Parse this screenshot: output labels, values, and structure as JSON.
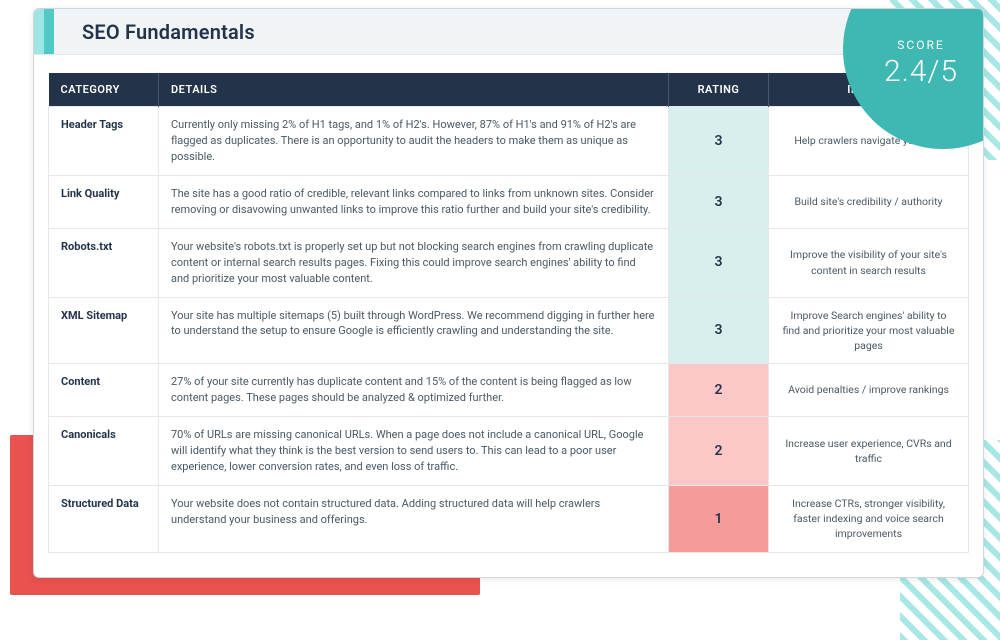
{
  "header": {
    "title": "SEO Fundamentals"
  },
  "score": {
    "label": "SCORE",
    "value": "2.4/5"
  },
  "table": {
    "headers": {
      "category": "CATEGORY",
      "details": "DETAILS",
      "rating": "RATING",
      "impact": "IMPACT"
    },
    "rows": [
      {
        "category": "Header Tags",
        "details": "Currently only missing 2% of H1 tags, and 1% of H2's. However, 87% of H1's and 91% of H2's are flagged as duplicates. There is an opportunity to audit the headers to make them as unique as possible.",
        "rating": "3",
        "rating_level": "good",
        "impact": "Help crawlers navigate your site"
      },
      {
        "category": "Link Quality",
        "details": "The site has a good ratio of credible, relevant links compared to links from unknown sites. Consider removing or disavowing unwanted links to improve this ratio further and build your site's credibility.",
        "rating": "3",
        "rating_level": "good",
        "impact": "Build site's credibility / authority"
      },
      {
        "category": "Robots.txt",
        "details": "Your website's robots.txt is properly set up but not blocking search engines from crawling duplicate content or internal search results pages. Fixing this could improve search engines' ability to find and prioritize your most valuable content.",
        "rating": "3",
        "rating_level": "good",
        "impact": "Improve the visibility of your site's content in search results"
      },
      {
        "category": "XML Sitemap",
        "details": "Your site has multiple sitemaps (5) built through WordPress. We recommend digging in further here to understand the setup to ensure Google is efficiently crawling and understanding the site.",
        "rating": "3",
        "rating_level": "good",
        "impact": "Improve Search engines' ability to find and prioritize your most valuable pages"
      },
      {
        "category": "Content",
        "details": "27% of your site currently has duplicate content and 15% of the content is being flagged as low content pages. These pages should be analyzed & optimized further.",
        "rating": "2",
        "rating_level": "warn",
        "impact": "Avoid penalties / improve rankings"
      },
      {
        "category": "Canonicals",
        "details": "70% of URLs are missing canonical URLs. When a page does not include a canonical URL, Google will identify what they think is the best version to send users to. This can lead to a poor user experience, lower conversion rates, and even loss of traffic.",
        "rating": "2",
        "rating_level": "warn",
        "impact": "Increase user experience, CVRs and traffic"
      },
      {
        "category": "Structured Data",
        "details": "Your website does not contain structured data. Adding structured data will help crawlers understand your business and offerings.",
        "rating": "1",
        "rating_level": "bad",
        "impact": "Increase CTRs, stronger visibility, faster indexing and voice search improvements"
      }
    ]
  }
}
